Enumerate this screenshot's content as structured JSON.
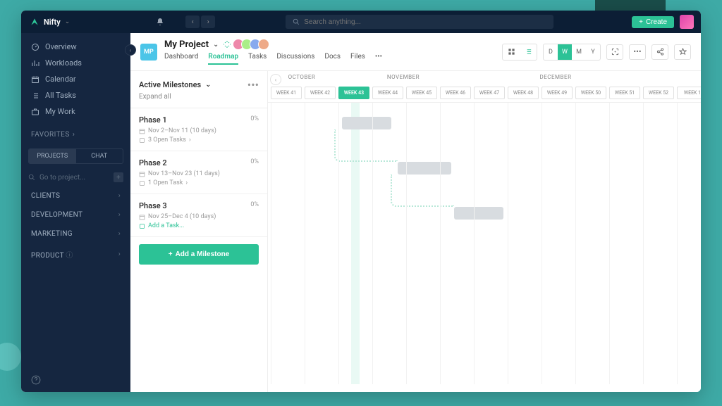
{
  "app": {
    "name": "Nifty"
  },
  "top": {
    "search_placeholder": "Search anything...",
    "create_label": "Create"
  },
  "sidebar": {
    "nav": [
      {
        "label": "Overview",
        "icon": "gauge"
      },
      {
        "label": "Workloads",
        "icon": "chart"
      },
      {
        "label": "Calendar",
        "icon": "calendar"
      },
      {
        "label": "All Tasks",
        "icon": "list"
      },
      {
        "label": "My Work",
        "icon": "briefcase"
      }
    ],
    "favorites_label": "FAVORITES",
    "tabs": {
      "projects": "PROJECTS",
      "chat": "CHAT"
    },
    "goto_placeholder": "Go to project...",
    "workspaces": [
      {
        "label": "CLIENTS"
      },
      {
        "label": "DEVELOPMENT"
      },
      {
        "label": "MARKETING"
      },
      {
        "label": "PRODUCT",
        "info": true
      }
    ]
  },
  "project": {
    "badge": "MP",
    "title": "My Project",
    "tabs": [
      "Dashboard",
      "Roadmap",
      "Tasks",
      "Discussions",
      "Docs",
      "Files"
    ],
    "active_tab": "Roadmap",
    "scale": [
      "D",
      "W",
      "M",
      "Y"
    ],
    "active_scale": "W"
  },
  "milestones": {
    "header": "Active Milestones",
    "expand": "Expand all",
    "add_button": "Add a Milestone",
    "items": [
      {
        "title": "Phase 1",
        "pct": "0%",
        "dates": "Nov 2–Nov 11 (10 days)",
        "tasks": "3 Open Tasks",
        "add": false
      },
      {
        "title": "Phase 2",
        "pct": "0%",
        "dates": "Nov 13–Nov 23 (11 days)",
        "tasks": "1 Open Task",
        "add": false
      },
      {
        "title": "Phase 3",
        "pct": "0%",
        "dates": "Nov 25–Dec 4 (10 days)",
        "tasks": "Add a Task...",
        "add": true
      }
    ]
  },
  "timeline": {
    "months": [
      {
        "label": "OCTOBER",
        "span": 2
      },
      {
        "label": "NOVEMBER",
        "span": 4
      },
      {
        "label": "DECEMBER",
        "span": 5
      }
    ],
    "weeks": [
      "WEEK 41",
      "WEEK 42",
      "WEEK 43",
      "WEEK 44",
      "WEEK 45",
      "WEEK 46",
      "WEEK 47",
      "WEEK 48",
      "WEEK 49",
      "WEEK 50",
      "WEEK 51",
      "WEEK 52",
      "WEEK 1"
    ],
    "active_week": "WEEK 43"
  }
}
